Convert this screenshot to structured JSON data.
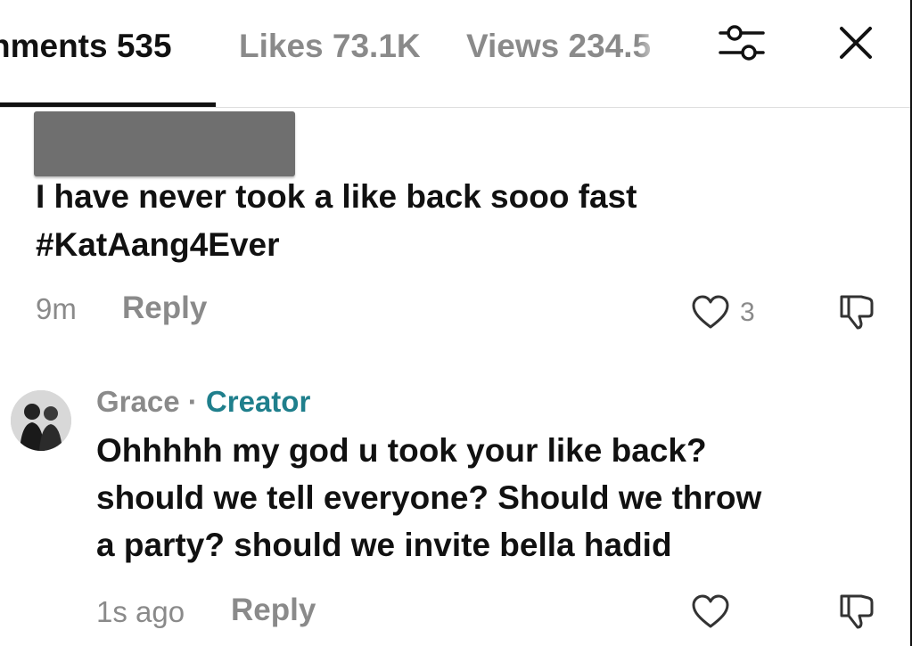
{
  "tabs": {
    "comments": "nments 535",
    "likes": "Likes 73.1K",
    "views": "Views 234.5"
  },
  "icons": {
    "filter": "sliders-icon",
    "close": "close-icon"
  },
  "comments": [
    {
      "text_line1": "I have never took a like back sooo fast",
      "text_line2": "#KatAang4Ever",
      "time": "9m",
      "reply": "Reply",
      "likes": "3"
    },
    {
      "author": "Grace",
      "separator": "·",
      "badge": "Creator",
      "text_line1": "Ohhhhh my god u took your like back?",
      "text_line2": "should we tell everyone? Should we throw",
      "text_line3": "a party? should we invite bella hadid",
      "time": "1s ago",
      "reply": "Reply"
    }
  ],
  "colors": {
    "accent": "#1f7f8c",
    "muted": "#8a8a8a",
    "text": "#111111"
  }
}
